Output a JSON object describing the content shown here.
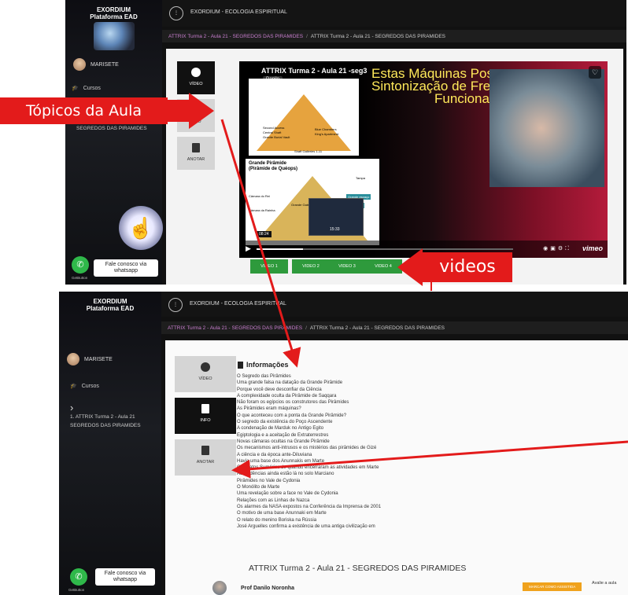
{
  "shot1": {
    "brand": [
      "EXORDIUM",
      "Plataforma EAD"
    ],
    "user_name": "MARISETE",
    "nav_cursos": "Cursos",
    "lesson_nav": "SEGREDOS DAS PIRAMIDES",
    "course_title": "EXORDIUM - ECOLOGIA ESPIRITUAL",
    "breadcrumb": [
      "ATTRIX Turma 2 - Aula 21 - SEGREDOS DAS PIRAMIDES",
      "ATTRIX Turma 2 - Aula 21 - SEGREDOS DAS PIRAMIDES"
    ],
    "tabs": {
      "video": "VÍDEO",
      "info": "INFO",
      "anotar": "ANOTAR"
    },
    "video": {
      "title": "ATTRIX Turma 2 - Aula 21 -seg3",
      "presenter_tag": "Danilo",
      "big_text": [
        "Estas Máquinas Poss",
        "Sintonização de Frec",
        "Funciona"
      ],
      "diagram1_labels": [
        "Second Access",
        "Central Shaft",
        "Granite Burial Vault",
        "Blue Chambers",
        "King's Apartment",
        "Shaft Galleries 1-11"
      ],
      "diagram2_title": [
        "Grande Pirâmide",
        "(Pirâmide de Quéops)"
      ],
      "diagram2_labels": [
        "Câmara do Rei",
        "Grande Galeria",
        "Câmara da Rainha",
        "Tampa",
        "Grande espaço",
        "espaço"
      ],
      "timestamp": "15:33",
      "elapsed": "08:24",
      "progress": 0.18,
      "vimeo": "vimeo",
      "heart_icon": "heart-icon"
    },
    "video_buttons": [
      "VIDEO 1",
      "VIDEO 2",
      "VIDEO 3",
      "VIDEO 4"
    ],
    "whatsapp": "Fale conosco via whatsapp",
    "getbutton": "GetButton"
  },
  "shot2": {
    "brand": [
      "EXORDIUM",
      "Plataforma EAD"
    ],
    "user_name": "MARISETE",
    "nav_cursos": "Cursos",
    "lesson_nav": [
      "1. ATTRIX Turma 2 - Aula 21",
      "SEGREDOS DAS PIRAMIDES"
    ],
    "course_title": "EXORDIUM - ECOLOGIA ESPIRITUAL",
    "breadcrumb": [
      "ATTRIX Turma 2 - Aula 21 - SEGREDOS DAS PIRAMIDES",
      "ATTRIX Turma 2 - Aula 21 - SEGREDOS DAS PIRAMIDES"
    ],
    "tabs": {
      "video": "VÍDEO",
      "info": "INFO",
      "anotar": "ANOTAR"
    },
    "info_title": "Informações",
    "topics": [
      "O Segredo das Pirâmides",
      "Uma grande falsa na datação da Grande Pirâmide",
      "Porque você deve desconfiar da Ciência",
      "A complexidade oculta da Pirâmide de Saqqara",
      "Não foram os egípcios os construtores das Pirâmides",
      "As Pirâmides eram máquinas?",
      "O que aconteceu com a ponta da Grande Pirâmide?",
      "O segredo da existência do Poço Ascendente",
      "A condenação de Marduk no Antigo Egito",
      "Egiptologia e a aceitação de Extraterrestres",
      "Novas câmaras ocultas na Grande Pirâmide",
      "Os mecanismos anti-intrusos e os mistérios das pirâmides de Gizé",
      "A ciência e da época ante-Diluviana",
      "Havia uma base dos Anunnakis em Marte",
      "Os relatos Sumérios de quando encerraram as atividades em Marte",
      "As evidências ainda estão lá no solo Marciano",
      "Pirâmides no Vale de Cydonia",
      "O Monólito de Marte",
      "Uma revelação sobre a face no Vale de Cydonia",
      "Relações com as Linhas de Nazca",
      "Os alarmes da NASA expostos na Conferência da Imprensa de 2001",
      "O motivo de uma base Anunnaki em Marte",
      "O relato do menino Boriska na Rússia",
      "José Arguelles confirma a existência de uma antiga civilização em"
    ],
    "lesson_title": "ATTRIX Turma 2 - Aula 21 - SEGREDOS DAS PIRAMIDES",
    "prof": "Prof Danilo Noronha",
    "mark_button": "MARCAR COMO ASSISTIDA",
    "rate": "Avalie a aula",
    "whatsapp": "Fale conosco via whatsapp",
    "getbutton": "GetButton"
  },
  "annotations": {
    "topics_callout": "Tópicos da Aula",
    "videos_callout": "videos",
    "callout_color": "#e31b1b"
  }
}
